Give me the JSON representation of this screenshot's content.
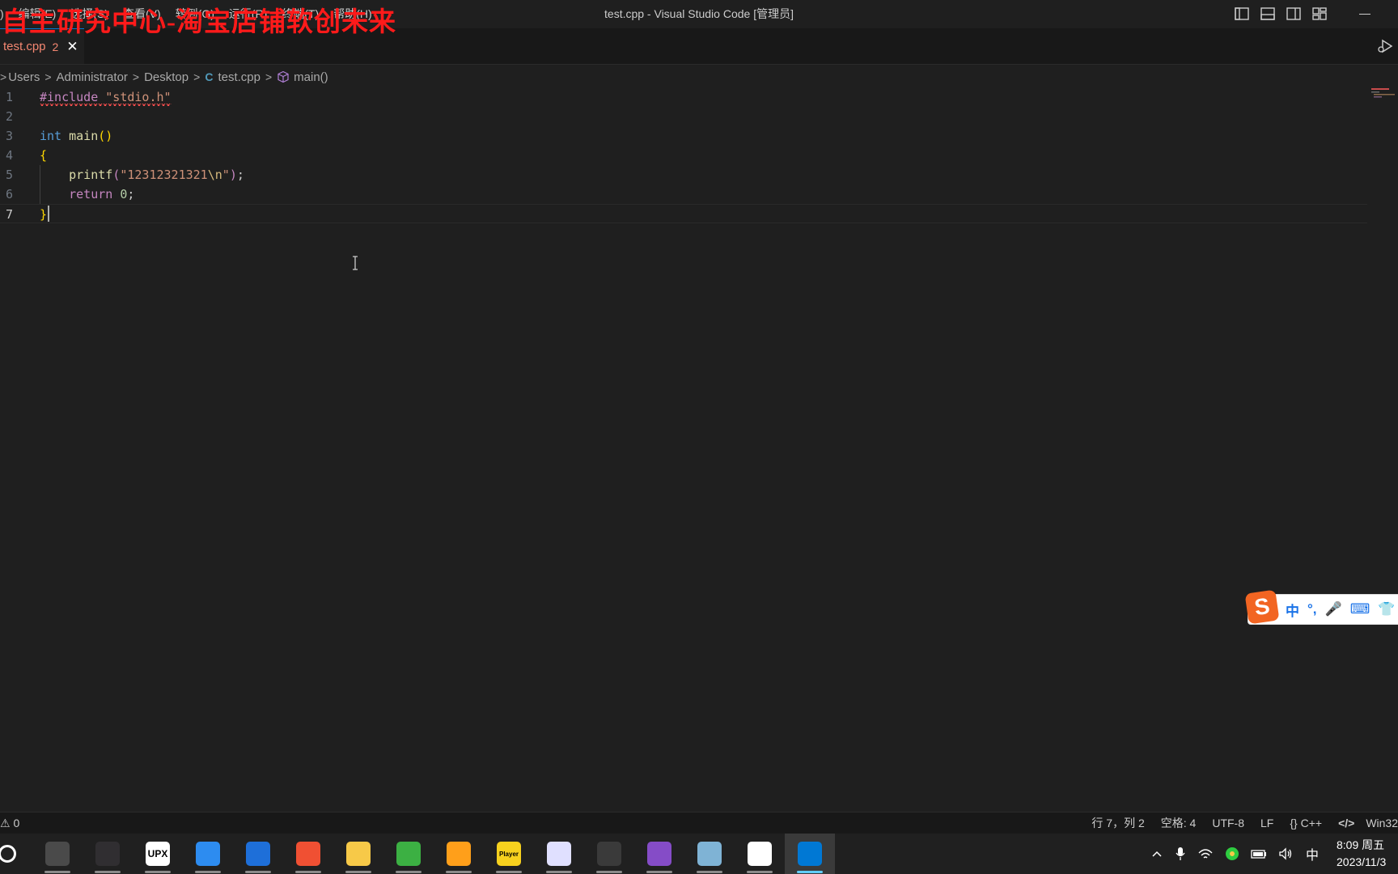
{
  "window": {
    "title": "test.cpp - Visual Studio Code [管理员]"
  },
  "menu": [
    {
      "label": ")"
    },
    {
      "label": "编辑(E)"
    },
    {
      "label": "选择(S)"
    },
    {
      "label": "查看(V)"
    },
    {
      "label": "转到(G)"
    },
    {
      "label": "运行(R)"
    },
    {
      "label": "终端(T)"
    },
    {
      "label": "帮助(H)"
    }
  ],
  "watermark": "自主研究中心-淘宝店铺软创未来",
  "tab": {
    "name": "test.cpp",
    "problem_count": "2",
    "close": "✕"
  },
  "breadcrumb": {
    "items": [
      "Users",
      "Administrator",
      "Desktop",
      "test.cpp",
      "main()"
    ],
    "separator": ">",
    "file_icon": "C"
  },
  "editor": {
    "line_numbers": [
      "1",
      "2",
      "3",
      "4",
      "5",
      "6",
      "7"
    ],
    "lines": [
      {
        "tokens": [
          {
            "t": "#include",
            "c": "pre"
          },
          {
            "t": " ",
            "c": "txt"
          },
          {
            "t": "\"stdio.h\"",
            "c": "str"
          }
        ],
        "squiggle": true
      },
      {
        "tokens": []
      },
      {
        "tokens": [
          {
            "t": "int",
            "c": "type"
          },
          {
            "t": " ",
            "c": "txt"
          },
          {
            "t": "main",
            "c": "fn"
          },
          {
            "t": "()",
            "c": "br"
          }
        ]
      },
      {
        "tokens": [
          {
            "t": "{",
            "c": "br"
          }
        ]
      },
      {
        "tokens": [
          {
            "t": "    ",
            "c": "txt"
          },
          {
            "t": "printf",
            "c": "fn"
          },
          {
            "t": "(",
            "c": "ctl"
          },
          {
            "t": "\"12312321321",
            "c": "str"
          },
          {
            "t": "\\n",
            "c": "esc"
          },
          {
            "t": "\"",
            "c": "str"
          },
          {
            "t": ")",
            "c": "ctl"
          },
          {
            "t": ";",
            "c": "txt"
          }
        ]
      },
      {
        "tokens": [
          {
            "t": "    ",
            "c": "txt"
          },
          {
            "t": "return",
            "c": "ctl"
          },
          {
            "t": " ",
            "c": "txt"
          },
          {
            "t": "0",
            "c": "num"
          },
          {
            "t": ";",
            "c": "txt"
          }
        ]
      },
      {
        "tokens": [
          {
            "t": "}",
            "c": "br"
          }
        ]
      }
    ],
    "active_line": 7
  },
  "ime": {
    "logo": "S",
    "mode": "中",
    "punct": "°,",
    "mic": "🎤",
    "keyboard": "⌨",
    "skin": "👕"
  },
  "status": {
    "warnings": "⚠ 0",
    "position": "行 7，列 2",
    "spaces": "空格: 4",
    "encoding": "UTF-8",
    "eol": "LF",
    "language": "{} C++",
    "platform": "Win32"
  },
  "taskbar": {
    "apps": [
      {
        "name": "search",
        "label": "",
        "color": "#202020"
      },
      {
        "name": "notes",
        "label": "",
        "color": "#4a4a4a"
      },
      {
        "name": "obs",
        "label": "",
        "color": "#302e31"
      },
      {
        "name": "upx",
        "label": "UPX",
        "color": "#ffffff"
      },
      {
        "name": "book",
        "label": "",
        "color": "#2d8cf0"
      },
      {
        "name": "store",
        "label": "",
        "color": "#1e6fd9"
      },
      {
        "name": "git",
        "label": "",
        "color": "#f05033"
      },
      {
        "name": "explorer",
        "label": "",
        "color": "#f7c948"
      },
      {
        "name": "browser",
        "label": "",
        "color": "#3cb043"
      },
      {
        "name": "music",
        "label": "",
        "color": "#ff9f1a"
      },
      {
        "name": "player",
        "label": "Player",
        "color": "#f7d11e"
      },
      {
        "name": "bird",
        "label": "",
        "color": "#e0e0ff"
      },
      {
        "name": "media",
        "label": "",
        "color": "#3a3a3a"
      },
      {
        "name": "visual-studio",
        "label": "",
        "color": "#854cc7"
      },
      {
        "name": "editor",
        "label": "",
        "color": "#7fb3d5"
      },
      {
        "name": "todesk",
        "label": "",
        "color": "#ffffff"
      },
      {
        "name": "vscode",
        "label": "",
        "color": "#0078d4"
      }
    ],
    "ime_indicator": "中",
    "time": "8:09 周五",
    "date": "2023/11/3"
  }
}
